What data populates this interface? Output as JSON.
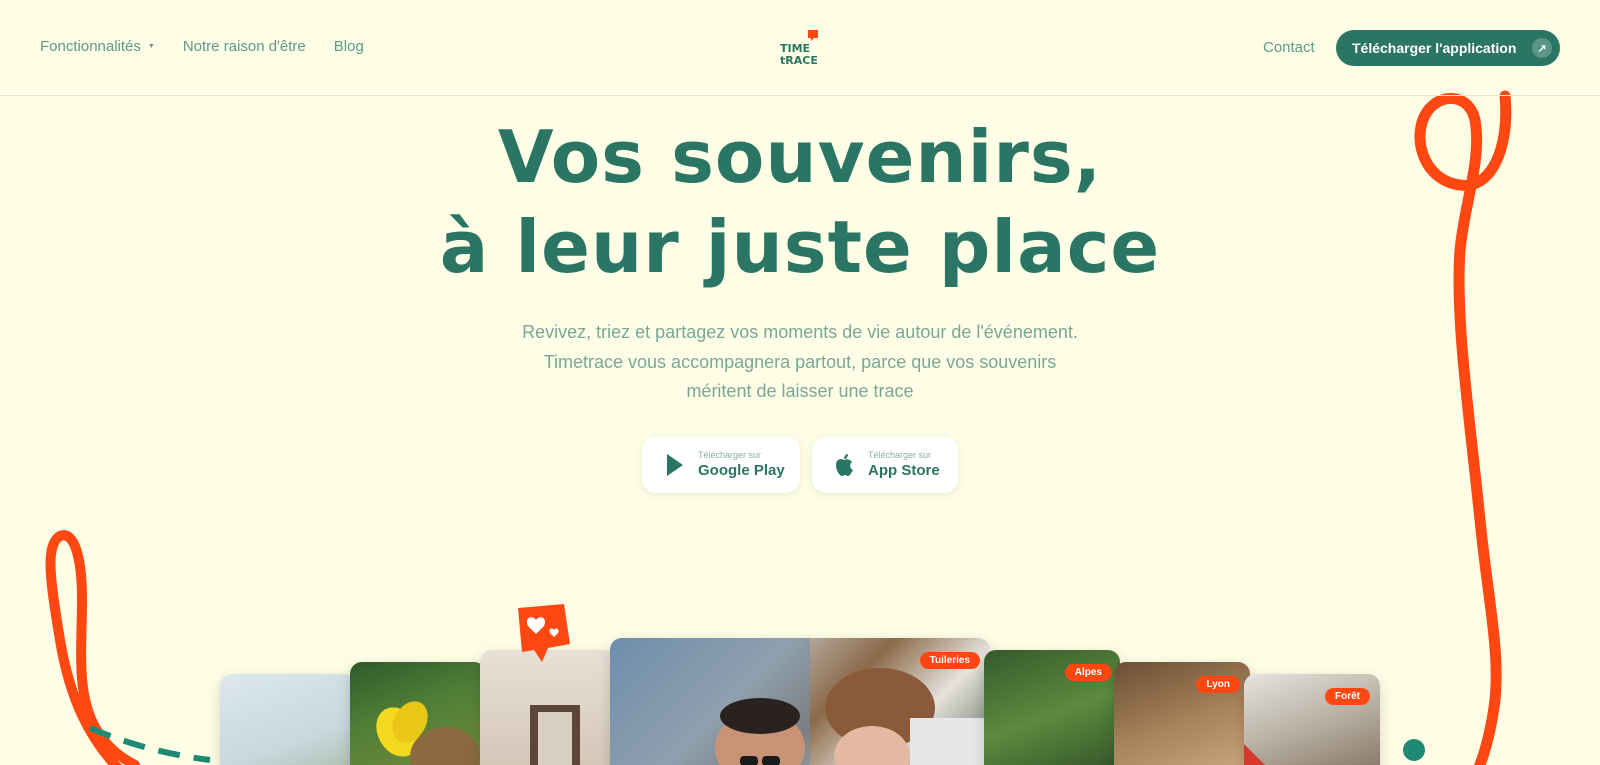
{
  "nav": {
    "items": [
      {
        "label": "Fonctionnalités",
        "caret": "▼"
      },
      {
        "label": "Notre raison d'être"
      },
      {
        "label": "Blog"
      }
    ],
    "contact": "Contact",
    "cta_label": "Télécharger l'application",
    "cta_icon": "arrow-up-right-icon",
    "cta_glyph": "↗"
  },
  "logo": {
    "line1": "TIME",
    "line2": "tRACE"
  },
  "hero": {
    "title_line1": "Vos souvenirs,",
    "title_line2": "à leur juste place",
    "subtitle_line1": "Revivez, triez et partagez vos moments de vie autour de l'événement.",
    "subtitle_line2": "Timetrace vous accompagnera partout, parce que vos souvenirs",
    "subtitle_line3": "méritent de laisser une trace"
  },
  "stores": {
    "google": {
      "small": "Télécharger sur",
      "big": "Google Play"
    },
    "apple": {
      "small": "Télécharger sur",
      "big": "App Store"
    }
  },
  "photos": {
    "tags": [
      "Tuileries",
      "Alpes",
      "Lyon",
      "Forêt"
    ]
  },
  "colors": {
    "background": "#FEFEE6",
    "primary": "#2B7565",
    "accent": "#FF4712"
  }
}
